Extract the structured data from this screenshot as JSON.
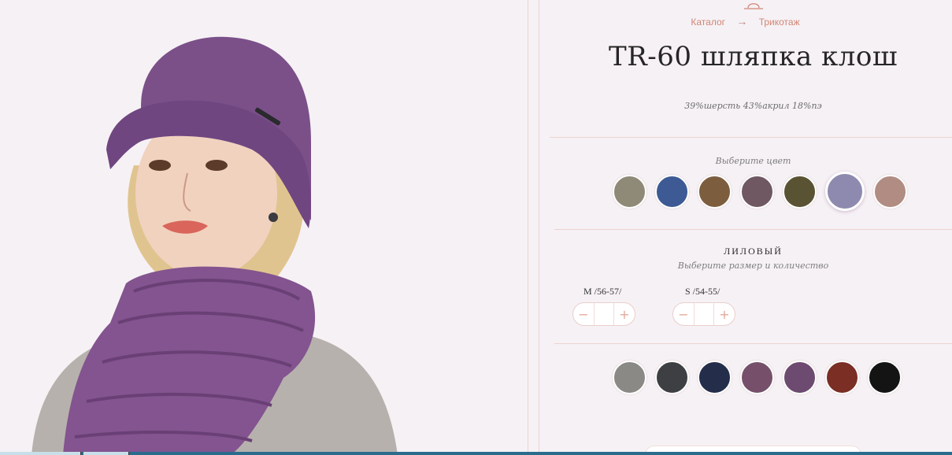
{
  "breadcrumb": {
    "items": [
      "Каталог",
      "Трикотаж"
    ],
    "separator": "→"
  },
  "product": {
    "title": "TR-60 шляпка клош",
    "composition": "39%шерсть 43%акрил 18%пэ"
  },
  "color_picker": {
    "prompt": "Выберите цвет",
    "selected_name": "ЛИЛОВЫЙ",
    "swatches": [
      {
        "color": "#8f8a78",
        "name": "grey-beige"
      },
      {
        "color": "#3d5a94",
        "name": "denim-blue"
      },
      {
        "color": "#7c5e3f",
        "name": "brown"
      },
      {
        "color": "#6f5862",
        "name": "taupe-purple"
      },
      {
        "color": "#5a5333",
        "name": "olive"
      },
      {
        "color": "#8e8aaf",
        "name": "lilac",
        "selected": true
      },
      {
        "color": "#b08c82",
        "name": "dusty-rose"
      }
    ]
  },
  "sizes": {
    "prompt": "Выберите размер и количество",
    "options": [
      {
        "label": "M /56-57/",
        "qty": ""
      },
      {
        "label": "S /54-55/",
        "qty": ""
      }
    ],
    "minus": "−",
    "plus": "+"
  },
  "scarf_colors": {
    "swatches": [
      {
        "color": "#8a8986",
        "name": "grey"
      },
      {
        "color": "#3d3f43",
        "name": "dark-grey"
      },
      {
        "color": "#242e4b",
        "name": "navy"
      },
      {
        "color": "#76506a",
        "name": "mauve"
      },
      {
        "color": "#6d4a70",
        "name": "purple"
      },
      {
        "color": "#7a2e24",
        "name": "burgundy"
      },
      {
        "color": "#141414",
        "name": "black"
      }
    ]
  },
  "colors": {
    "accent": "#d08674",
    "divider": "#ecd3cf",
    "background": "#f6f1f5"
  }
}
